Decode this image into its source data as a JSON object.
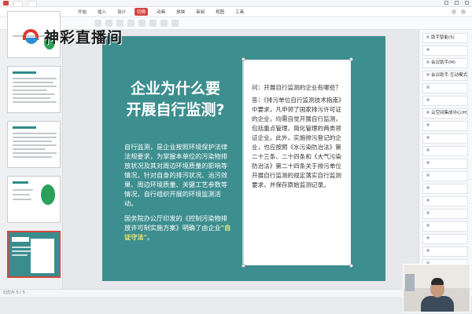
{
  "watermark": {
    "text": "神彩直播间"
  },
  "menubar": {
    "items": [
      "开始",
      "插入",
      "设计",
      "切换",
      "动画",
      "放映",
      "审阅",
      "视图",
      "工具"
    ],
    "active_index": 3
  },
  "slide": {
    "title_line1": "企业为什么要",
    "title_line2": "开展自行监测?",
    "body1": "自行监测，是企业按照环境保护法律法规要求，为掌握本单位的污染物排放状况及其对周边环境质量的影响等情况，针对自身的排污状况、治污效果、周边环境质量、关键工艺参数等情况，自行组织开展的环境监测活动。",
    "body2_prefix": "国务院办公厅印发的《控制污染物排放许可制实施方案》明确了由企业",
    "body2_highlight": "\"自证守法\"",
    "body2_suffix": "。",
    "qa_question": "问：开展自行监测的企业有哪些？",
    "qa_answer": "答：《排污单位自行监测技术指南》中要求，凡申领了国家排污许可证的企业，均需自觉开展自行监测，包括重点管理、简化管理的两类领证企业。此外，实施排污登记的企业，也应按照《水污染防治法》第二十三条、二十四条和《大气污染防治法》第二十四条关于排污单位开展自行监测的规定落实自行监测要求，并保存原始监测记录。"
  },
  "thumbnails": [
    {
      "num": "",
      "style": "partial"
    },
    {
      "num": "",
      "style": "text"
    },
    {
      "num": "",
      "style": "text"
    },
    {
      "num": "",
      "style": "green"
    },
    {
      "num": "",
      "style": "teal",
      "selected": true
    }
  ],
  "right_panel": {
    "items": [
      "助手智能(S)",
      "",
      "会议助手(M)",
      "会议助手-互动模式",
      "",
      "",
      "云空间集成中心(H)",
      "",
      "",
      "",
      "",
      "",
      "",
      "",
      "",
      "",
      "",
      "",
      "",
      ""
    ]
  },
  "statusbar": {
    "left": "幻灯片 5 / 5",
    "right": ""
  }
}
